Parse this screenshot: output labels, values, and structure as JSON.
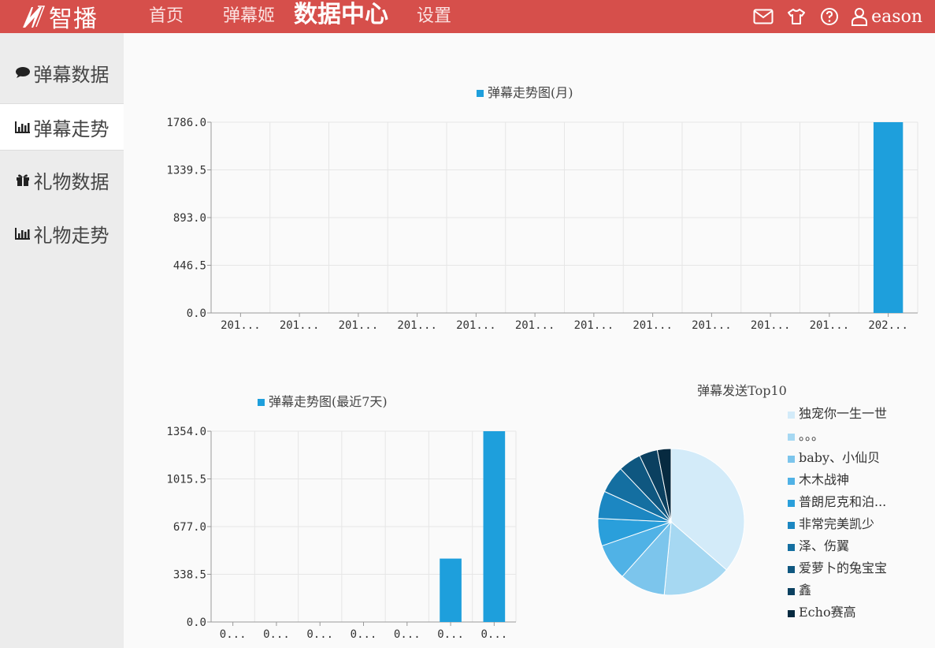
{
  "header": {
    "logo_text": "智播",
    "nav": [
      {
        "label": "首页",
        "active": false
      },
      {
        "label": "弹幕姬",
        "active": false
      },
      {
        "label": "数据中心",
        "active": true
      },
      {
        "label": "设置",
        "active": false
      }
    ],
    "icons": [
      "mail-icon",
      "shirt-icon",
      "help-icon",
      "user-icon"
    ],
    "user_name": "eason"
  },
  "sidebar": {
    "items": [
      {
        "label": "弹幕数据",
        "icon": "comment-icon",
        "active": false
      },
      {
        "label": "弹幕走势",
        "icon": "bar-chart-icon",
        "active": true
      },
      {
        "label": "礼物数据",
        "icon": "gift-icon",
        "active": false
      },
      {
        "label": "礼物走势",
        "icon": "bar-chart-icon",
        "active": false
      }
    ]
  },
  "colors": {
    "accent": "#d64f4b",
    "bar": "#1e9fdc"
  },
  "chart_data": [
    {
      "type": "bar",
      "legend": "弹幕走势图(月)",
      "categories": [
        "201...",
        "201...",
        "201...",
        "201...",
        "201...",
        "201...",
        "201...",
        "201...",
        "201...",
        "201...",
        "201...",
        "202..."
      ],
      "values": [
        0,
        0,
        0,
        0,
        0,
        0,
        0,
        0,
        0,
        0,
        0,
        1786
      ],
      "yticks": [
        "0.0",
        "446.5",
        "893.0",
        "1339.5",
        "1786.0"
      ],
      "ylim": [
        0,
        1786
      ]
    },
    {
      "type": "bar",
      "legend": "弹幕走势图(最近7天)",
      "categories": [
        "0...",
        "0...",
        "0...",
        "0...",
        "0...",
        "0...",
        "0..."
      ],
      "values": [
        0,
        0,
        0,
        0,
        0,
        450,
        1354
      ],
      "yticks": [
        "0.0",
        "338.5",
        "677.0",
        "1015.5",
        "1354.0"
      ],
      "ylim": [
        0,
        1354
      ]
    },
    {
      "type": "pie",
      "title": "弹幕发送Top10",
      "labels": [
        "独宠你一生一世",
        "。。。",
        "baby、小仙贝",
        "木木战神",
        "普朗尼克和泊...",
        "非常完美凯少",
        "泽、伤翼",
        "爱萝卜的兔宝宝",
        "鑫",
        "Echo赛高"
      ],
      "values": [
        36,
        15,
        10,
        8,
        6,
        6,
        6,
        5,
        4,
        3
      ],
      "colors": [
        "#d3ebf9",
        "#a6d8f2",
        "#7cc5ec",
        "#50b2e6",
        "#2a9fdb",
        "#1c87c2",
        "#146fa1",
        "#0f5780",
        "#0b4060",
        "#072a40"
      ]
    }
  ]
}
